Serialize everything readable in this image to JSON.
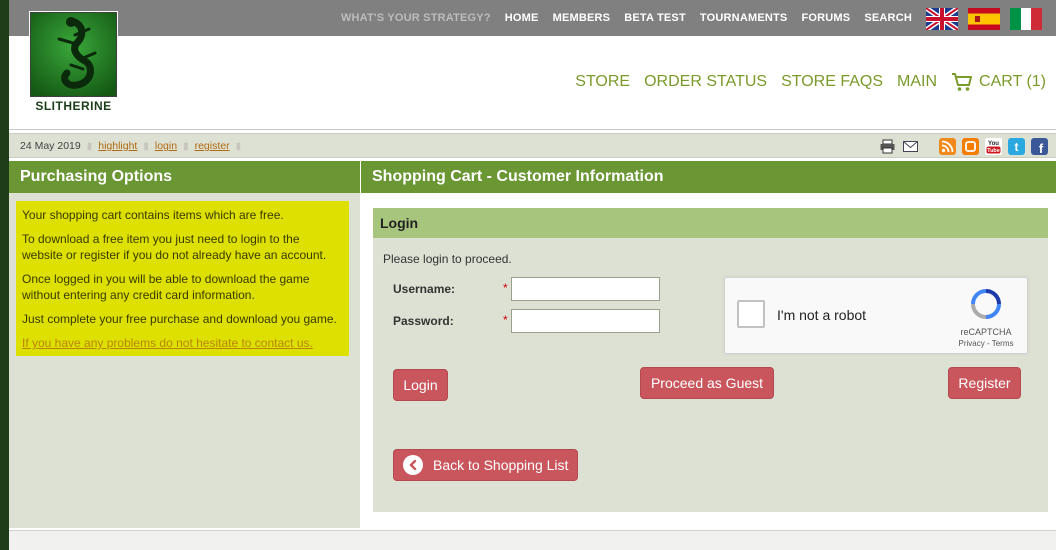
{
  "topnav": {
    "strategy": "WHAT'S YOUR STRATEGY?",
    "items": [
      "HOME",
      "MEMBERS",
      "BETA TEST",
      "TOURNAMENTS",
      "FORUMS",
      "SEARCH"
    ]
  },
  "flags": [
    "uk-flag-icon",
    "spain-flag-icon",
    "italy-flag-icon"
  ],
  "logo": {
    "text": "SLITHERINE"
  },
  "storenav": {
    "items": [
      "STORE",
      "ORDER STATUS",
      "STORE FAQS",
      "MAIN"
    ],
    "cart": "CART (1)"
  },
  "datebar": {
    "date": "24 May 2019",
    "links": [
      "highlight",
      "login",
      "register"
    ]
  },
  "social_icons": [
    "print-icon",
    "email-icon",
    "rss-icon",
    "blogger-icon",
    "youtube-icon",
    "twitter-icon",
    "facebook-icon"
  ],
  "left": {
    "title": "Purchasing Options",
    "notice": [
      "Your shopping cart contains items which are free.",
      "To download a free item you just need to login to the website or register if you do not already have an account.",
      "Once logged in you will be able to download the game without entering any credit card information.",
      "Just complete your free purchase and download you game."
    ],
    "contact_link": "If you have any problems do not hesitate to contact us."
  },
  "right": {
    "title": "Shopping Cart - Customer Information",
    "panel_title": "Login",
    "prompt": "Please login to proceed.",
    "username_label": "Username:",
    "password_label": "Password:",
    "required_mark": "*",
    "username_value": "",
    "password_value": "",
    "captcha": {
      "label": "I'm not a robot",
      "brand": "reCAPTCHA",
      "links": "Privacy - Terms"
    },
    "buttons": {
      "login": "Login",
      "guest": "Proceed as Guest",
      "register": "Register",
      "back": "Back to Shopping List"
    }
  },
  "colors": {
    "accent_green": "#6a9634",
    "panel_green": "#a8c57d",
    "button_red": "#c9565d",
    "notice_yellow": "#dde000",
    "store_link": "#7a9a2a"
  }
}
